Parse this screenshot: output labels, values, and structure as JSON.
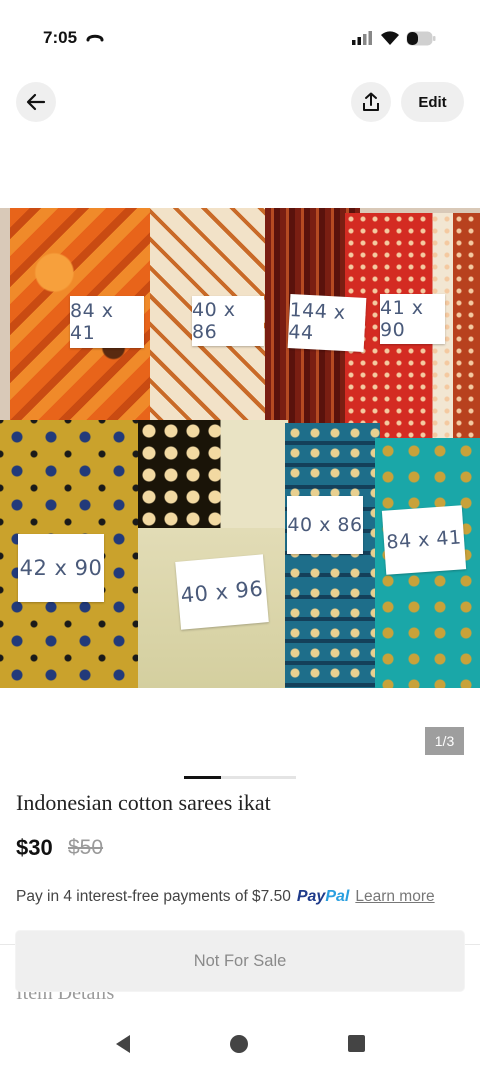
{
  "status": {
    "time": "7:05"
  },
  "header": {
    "edit_label": "Edit"
  },
  "photo": {
    "counter": "1/3",
    "tags": [
      "84 x 41",
      "40 x 86",
      "144 x 44",
      "41 x 90",
      "42 x 90",
      "40 x 96",
      "40 x 86",
      "84 x 41"
    ]
  },
  "listing": {
    "title": "Indonesian cotton sarees ikat",
    "price": "$30",
    "original_price": "$50",
    "paypal_text": "Pay in 4 interest-free payments of $7.50",
    "paypal_brand_1": "Pay",
    "paypal_brand_2": "Pal",
    "learn_more": "Learn more",
    "details_heading": "Item Details",
    "action_label": "Not For Sale"
  },
  "colors": {
    "paypal_dark": "#1e3a8a",
    "paypal_light": "#2a9fe0",
    "button_bg": "#efefef"
  },
  "icons": [
    "back-arrow-icon",
    "share-icon",
    "signal-icon",
    "wifi-icon",
    "battery-icon",
    "nav-back-icon",
    "nav-home-icon",
    "nav-recents-icon"
  ]
}
